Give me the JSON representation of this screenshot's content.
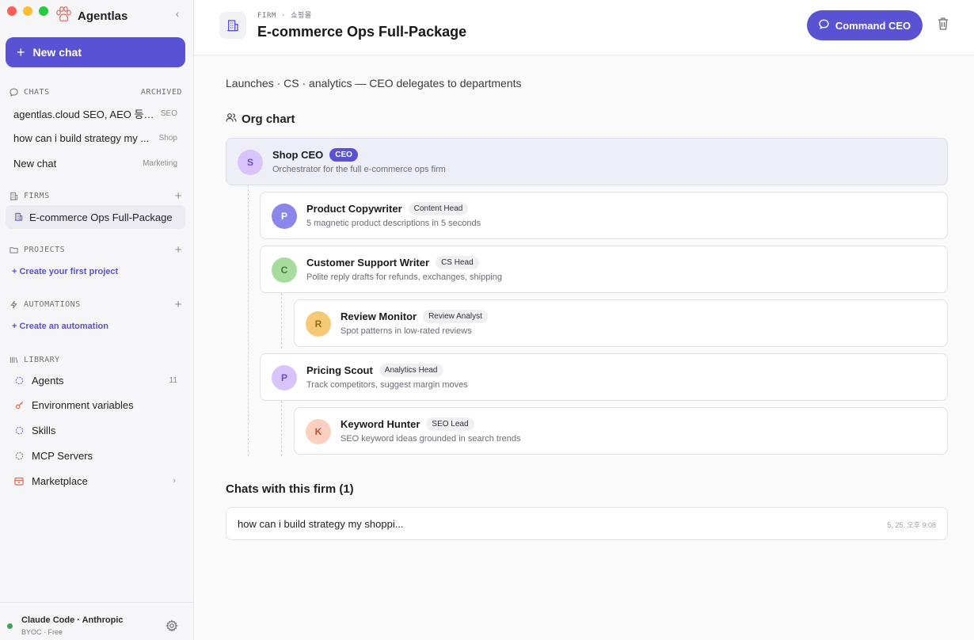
{
  "app": {
    "name": "Agentlas"
  },
  "sidebar": {
    "new_chat_label": "New chat",
    "chats": {
      "heading": "CHATS",
      "archived_label": "ARCHIVED",
      "items": [
        {
          "title": "agentlas.cloud SEO, AEO 등 ...",
          "tag": "SEO"
        },
        {
          "title": "how can i build strategy my ...",
          "tag": "Shop"
        },
        {
          "title": "New chat",
          "tag": "Marketing"
        }
      ]
    },
    "firms": {
      "heading": "FIRMS",
      "items": [
        {
          "title": "E-commerce Ops Full-Package"
        }
      ]
    },
    "projects": {
      "heading": "PROJECTS",
      "action": "+ Create your first project"
    },
    "automations": {
      "heading": "AUTOMATIONS",
      "action": "+ Create an automation"
    },
    "library": {
      "heading": "LIBRARY",
      "items": [
        {
          "label": "Agents",
          "count": "11",
          "icon": "agents-icon"
        },
        {
          "label": "Environment variables",
          "icon": "key-icon"
        },
        {
          "label": "Skills",
          "icon": "skills-icon"
        },
        {
          "label": "MCP Servers",
          "icon": "server-icon"
        },
        {
          "label": "Marketplace",
          "icon": "store-icon"
        }
      ]
    },
    "footer": {
      "name": "Claude Code · Anthropic",
      "plan": "BYOC · Free",
      "status_color": "#3aa655"
    }
  },
  "header": {
    "kicker": "FIRM · 쇼핑몰",
    "title": "E-commerce Ops Full-Package",
    "command_label": "Command CEO"
  },
  "main": {
    "description": "Launches · CS · analytics — CEO delegates to departments",
    "org_heading": "Org chart",
    "org": {
      "ceo": {
        "initial": "S",
        "name": "Shop CEO",
        "badge": "CEO",
        "desc": "Orchestrator for the full e-commerce ops firm"
      },
      "nodes": [
        {
          "initial": "P",
          "name": "Product Copywriter",
          "badge": "Content Head",
          "desc": "5 magnetic product descriptions in 5 seconds"
        },
        {
          "initial": "C",
          "name": "Customer Support Writer",
          "badge": "CS Head",
          "desc": "Polite reply drafts for refunds, exchanges, shipping"
        },
        {
          "initial": "R",
          "name": "Review Monitor",
          "badge": "Review Analyst",
          "desc": "Spot patterns in low-rated reviews"
        },
        {
          "initial": "P",
          "name": "Pricing Scout",
          "badge": "Analytics Head",
          "desc": "Track competitors, suggest margin moves"
        },
        {
          "initial": "K",
          "name": "Keyword Hunter",
          "badge": "SEO Lead",
          "desc": "SEO keyword ideas grounded in search trends"
        }
      ]
    },
    "chats_heading": "Chats with this firm (1)",
    "chats": [
      {
        "title": "how can i build strategy my shoppi...",
        "time": "5. 25. 오후 9:08"
      }
    ]
  },
  "colors": {
    "accent": "#5a52d5"
  }
}
